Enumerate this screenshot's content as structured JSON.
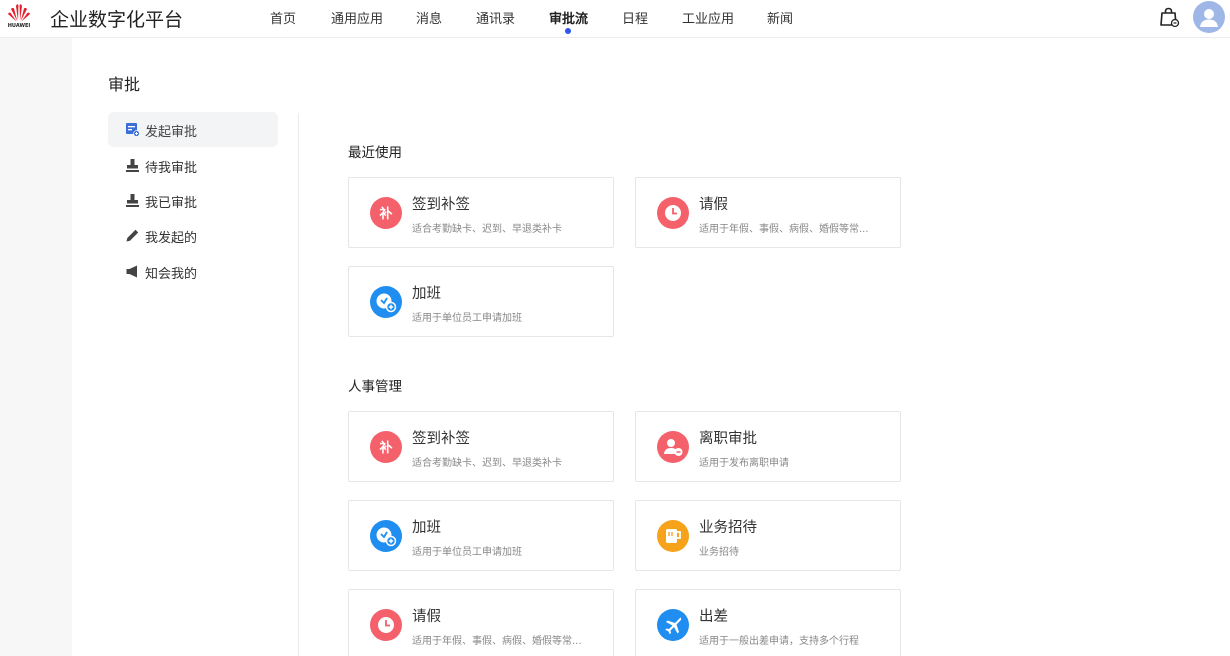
{
  "brand": {
    "wordmark": "HUAWEI",
    "app_title": "企业数字化平台",
    "logo_color": "#e5202e"
  },
  "nav": {
    "items": [
      {
        "label": "首页"
      },
      {
        "label": "通用应用"
      },
      {
        "label": "消息"
      },
      {
        "label": "通讯录"
      },
      {
        "label": "审批流",
        "active": true
      },
      {
        "label": "日程"
      },
      {
        "label": "工业应用"
      },
      {
        "label": "新闻"
      }
    ],
    "accent": "#2f54eb"
  },
  "header_icons": {
    "cart": "shopping-bag-icon",
    "avatar": "user-avatar-icon"
  },
  "page": {
    "title": "审批"
  },
  "sidebar": {
    "items": [
      {
        "label": "发起审批",
        "icon": "form-add-icon",
        "active": true
      },
      {
        "label": "待我审批",
        "icon": "stamp-icon"
      },
      {
        "label": "我已审批",
        "icon": "stamp-icon"
      },
      {
        "label": "我发起的",
        "icon": "pencil-icon"
      },
      {
        "label": "知会我的",
        "icon": "speaker-icon"
      }
    ]
  },
  "sections": [
    {
      "title": "最近使用",
      "cards": [
        {
          "title": "签到补签",
          "desc": "适合考勤缺卡、迟到、早退类补卡",
          "icon": "bu-icon",
          "color": "#f4616b"
        },
        {
          "title": "请假",
          "desc": "适用于年假、事假、病假、婚假等常...",
          "icon": "clock-icon",
          "color": "#f4616b"
        },
        {
          "title": "加班",
          "desc": "适用于单位员工申请加班",
          "icon": "overtime-clock-icon",
          "color": "#1f8ef0"
        }
      ]
    },
    {
      "title": "人事管理",
      "cards": [
        {
          "title": "签到补签",
          "desc": "适合考勤缺卡、迟到、早退类补卡",
          "icon": "bu-icon",
          "color": "#f4616b"
        },
        {
          "title": "离职审批",
          "desc": "适用于发布离职申请",
          "icon": "user-minus-icon",
          "color": "#f4616b"
        },
        {
          "title": "加班",
          "desc": "适用于单位员工申请加班",
          "icon": "overtime-clock-icon",
          "color": "#1f8ef0"
        },
        {
          "title": "业务招待",
          "desc": "业务招待",
          "icon": "cup-icon",
          "color": "#f7a21b"
        },
        {
          "title": "请假",
          "desc": "适用于年假、事假、病假、婚假等常...",
          "icon": "clock-icon",
          "color": "#f4616b"
        },
        {
          "title": "出差",
          "desc": "适用于一般出差申请，支持多个行程",
          "icon": "plane-icon",
          "color": "#1f8ef0"
        }
      ]
    }
  ]
}
